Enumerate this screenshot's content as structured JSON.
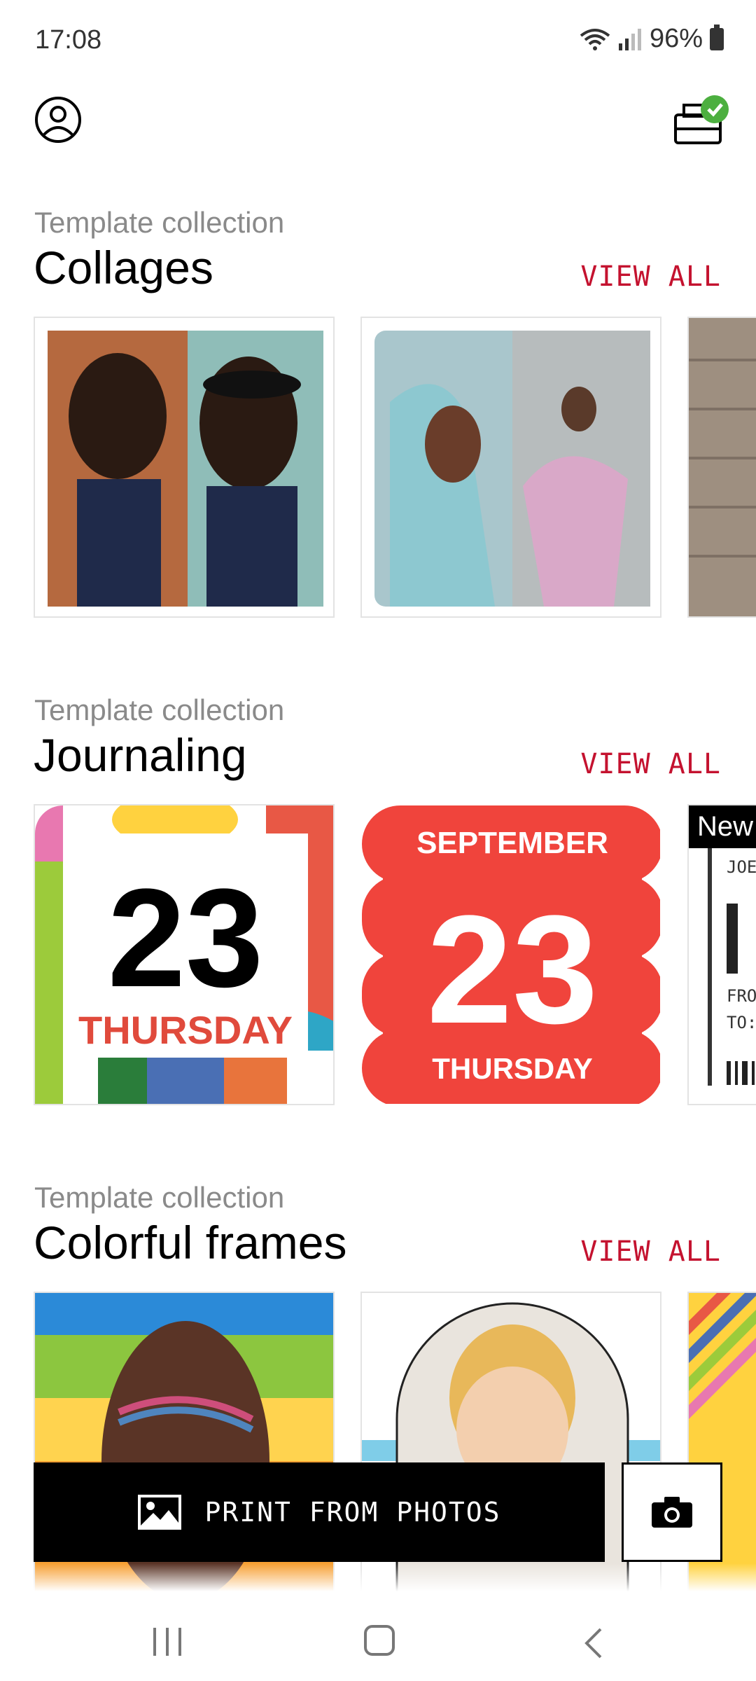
{
  "status": {
    "time": "17:08",
    "battery": "96%"
  },
  "sections": [
    {
      "kicker": "Template collection",
      "title": "Collages",
      "view_all": "VIEW ALL"
    },
    {
      "kicker": "Template collection",
      "title": "Journaling",
      "view_all": "VIEW ALL"
    },
    {
      "kicker": "Template collection",
      "title": "Colorful frames",
      "view_all": "VIEW ALL"
    }
  ],
  "journaling": {
    "card1": {
      "day_number": "23",
      "weekday": "THURSDAY"
    },
    "card2": {
      "month": "SEPTEMBER",
      "day_number": "23",
      "weekday": "THURSDAY"
    },
    "card3": {
      "badge": "New",
      "line1": "JOE",
      "line2": "FROM",
      "line3": "TO:"
    }
  },
  "cta": {
    "label": "PRINT FROM PHOTOS"
  },
  "icons": {
    "avatar": "account-icon",
    "printer": "printer-connected-icon",
    "photo": "image-icon",
    "camera": "camera-icon"
  },
  "colors": {
    "accent": "#c4122f",
    "check_green": "#4caf3f"
  }
}
